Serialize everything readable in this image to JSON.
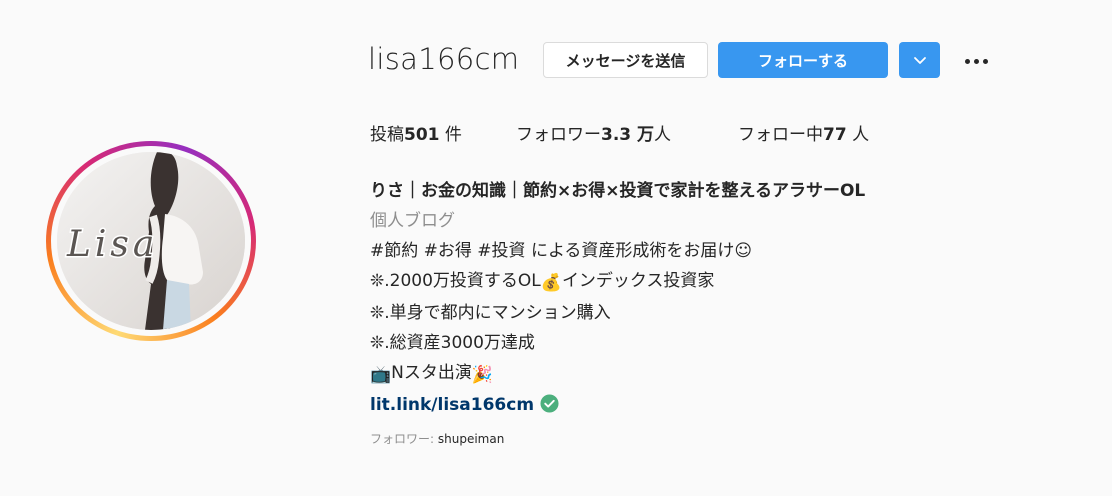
{
  "profile": {
    "username": "lisa166cm",
    "avatar_text": "Lisa"
  },
  "header": {
    "message_button": "メッセージを送信",
    "follow_button": "フォローする",
    "dropdown_icon": "chevron-down-icon",
    "more_icon": "more-options-icon"
  },
  "stats": {
    "posts_prefix": "投稿",
    "posts_value": "501",
    "posts_suffix": " 件",
    "followers_prefix": "フォロワー",
    "followers_value": "3.3 万",
    "followers_suffix": "人",
    "following_prefix": "フォロー中",
    "following_value": "77",
    "following_suffix": " 人"
  },
  "bio": {
    "name": "りさ｜お金の知識｜節約×お得×投資で家計を整えるアラサーOL",
    "category": "個人ブログ",
    "line1": "#節約 #お得 #投資 による資産形成術をお届け☺",
    "line2a": "❊.2000万投資するOL",
    "line2_emoji": "💰",
    "line2b": "インデックス投資家",
    "line3": "❊.単身で都内にマンション購入",
    "line4": "❊.総資産3000万達成",
    "line5_emoji": "📺",
    "line5": "Nスタ出演",
    "line5_emoji2": "🎉",
    "link": "lit.link/lisa166cm"
  },
  "followed_by": {
    "label": "フォロワー: ",
    "user": "shupeiman"
  },
  "colors": {
    "accent": "#3897f0",
    "text": "#262626",
    "muted": "#8e8e8e",
    "link": "#00376b",
    "verified": "#4caf7d"
  }
}
